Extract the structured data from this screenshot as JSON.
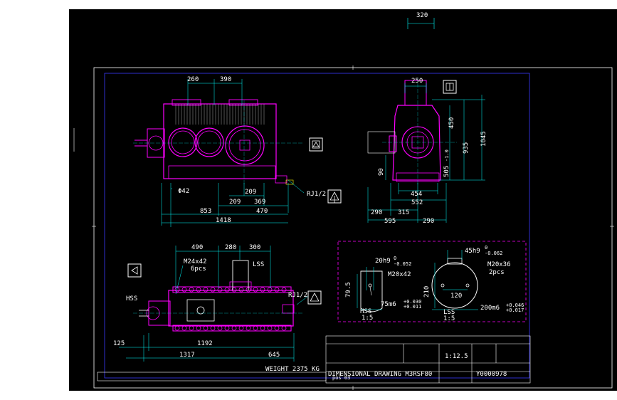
{
  "colors": {
    "background": "#000000",
    "border": "#ffffff",
    "inner_frame": "#3a3aff",
    "dimension": "#00ffff",
    "part": "#ff00ff",
    "text": "#ffffff",
    "highlight": "#00ff66"
  },
  "top_dim": "320",
  "front_view": {
    "dims_top": [
      "260",
      "390"
    ],
    "dims_bottom": [
      "Φ42",
      "209",
      "209",
      "369",
      "853",
      "470",
      "1418"
    ],
    "rj_label": "RJ1/2"
  },
  "side_view": {
    "dim_top": "250",
    "dims_right": [
      "450",
      "935",
      "1045",
      "505",
      "90"
    ],
    "dims_bottom": [
      "454",
      "552",
      "290",
      "315",
      "595",
      "290"
    ],
    "tol_505": "-1.0"
  },
  "plan_view": {
    "dims_top": [
      "490",
      "280",
      "300"
    ],
    "bolt_label": "M24x42",
    "bolt_qty": "6pcs",
    "lss_label": "LSS",
    "hss_label": "HSS",
    "rj_label": "RJ1/2",
    "dims_bottom": [
      "125",
      "1192",
      "1317",
      "645"
    ],
    "weight": "WEIGHT 2375 KG"
  },
  "shaft_detail": {
    "hss": {
      "key": "20h9",
      "key_tol_up": "0",
      "key_tol_low": "-0.052",
      "thread": "M20x42",
      "height": "79.5",
      "shaft": "75m6",
      "shaft_tol_up": "+0.030",
      "shaft_tol_low": "+0.011",
      "label": "HSS",
      "scale": "1:5"
    },
    "lss": {
      "key": "45h9",
      "key_tol_up": "0",
      "key_tol_low": "-0.062",
      "thread": "M20x36",
      "qty": "2pcs",
      "height": "210",
      "inner": "120",
      "shaft": "200m6",
      "shaft_tol_up": "+0.046",
      "shaft_tol_low": "+0.017",
      "label": "LSS",
      "scale": "1:5"
    }
  },
  "title_block": {
    "title": "DIMENSIONAL DRAWING M3RSF80",
    "doc_no": "Y0000978",
    "scale": "1:12.5",
    "pos": "pos 03"
  }
}
